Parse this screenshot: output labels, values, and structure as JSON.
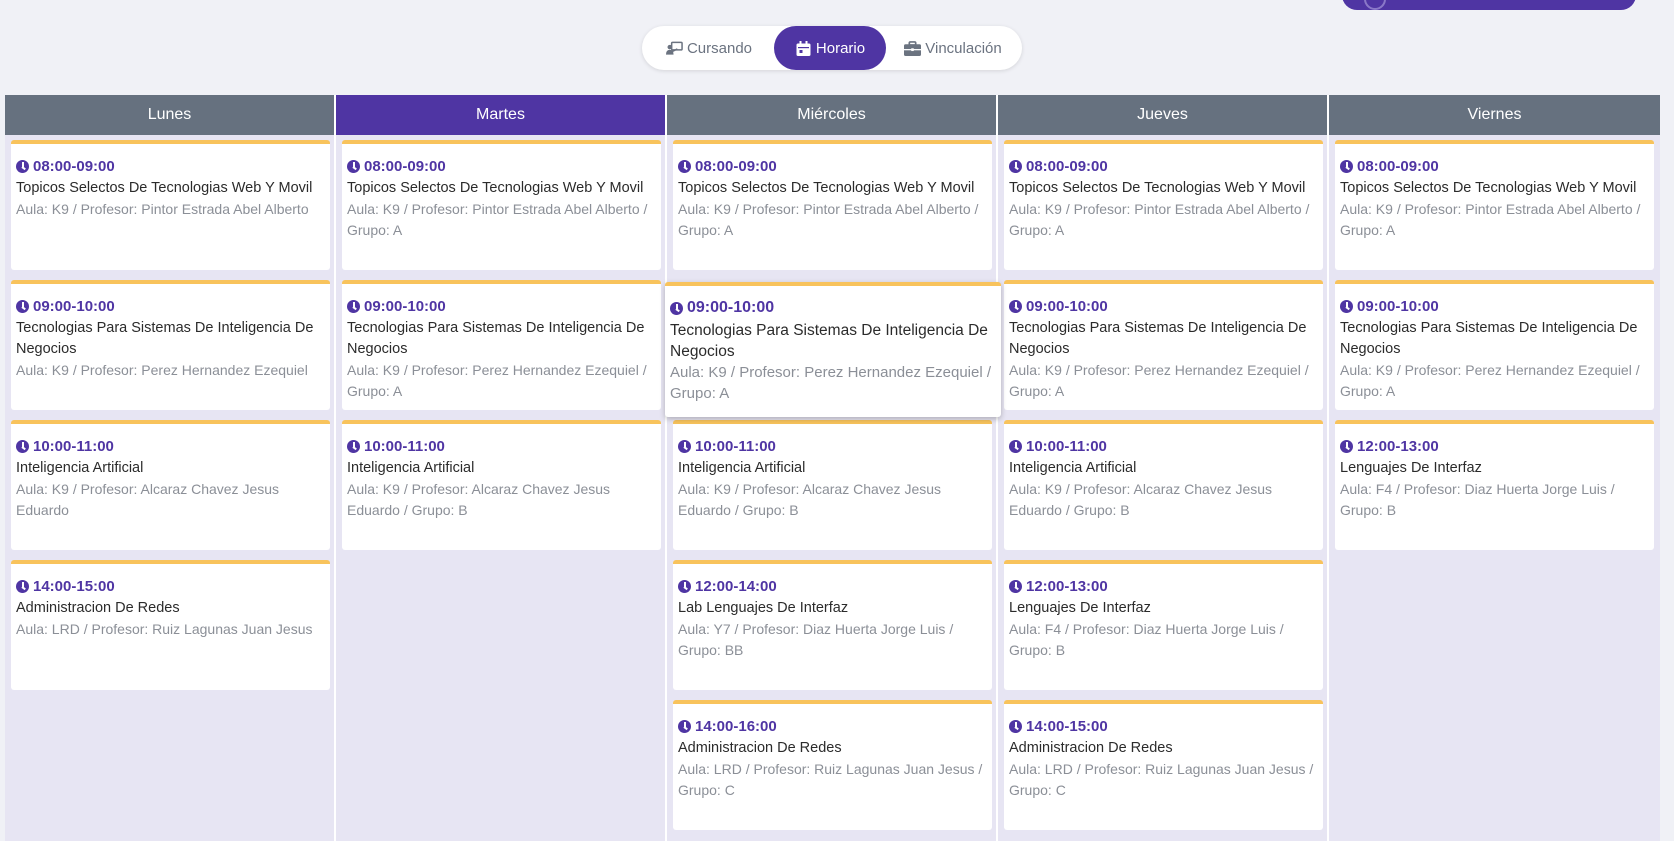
{
  "tabs": [
    {
      "label": "Cursando",
      "icon": "teacher-board-icon"
    },
    {
      "label": "Horario",
      "icon": "calendar-icon"
    },
    {
      "label": "Vinculación",
      "icon": "briefcase-icon"
    }
  ],
  "colors": {
    "primary": "#4f35a3",
    "header": "#66717f",
    "accent": "#f8c35c"
  },
  "days": [
    {
      "name": "Lunes",
      "active": false,
      "classes": [
        {
          "time": "08:00-09:00",
          "subject": "Topicos Selectos De Tecnologias Web Y Movil",
          "details": "Aula: K9 / Profesor: Pintor Estrada Abel Alberto"
        },
        {
          "time": "09:00-10:00",
          "subject": "Tecnologias Para Sistemas De Inteligencia De Negocios",
          "details": "Aula: K9 / Profesor: Perez Hernandez Ezequiel"
        },
        {
          "time": "10:00-11:00",
          "subject": "Inteligencia Artificial",
          "details": "Aula: K9 / Profesor: Alcaraz Chavez Jesus Eduardo"
        },
        {
          "time": "14:00-15:00",
          "subject": "Administracion De Redes",
          "details": "Aula: LRD / Profesor: Ruiz Lagunas Juan Jesus"
        }
      ]
    },
    {
      "name": "Martes",
      "active": true,
      "classes": [
        {
          "time": "08:00-09:00",
          "subject": "Topicos Selectos De Tecnologias Web Y Movil",
          "details": "Aula: K9 / Profesor: Pintor Estrada Abel Alberto / Grupo: A"
        },
        {
          "time": "09:00-10:00",
          "subject": "Tecnologias Para Sistemas De Inteligencia De Negocios",
          "details": "Aula: K9 / Profesor: Perez Hernandez Ezequiel / Grupo: A"
        },
        {
          "time": "10:00-11:00",
          "subject": "Inteligencia Artificial",
          "details": "Aula: K9 / Profesor: Alcaraz Chavez Jesus Eduardo / Grupo: B"
        }
      ]
    },
    {
      "name": "Miércoles",
      "active": false,
      "classes": [
        {
          "time": "08:00-09:00",
          "subject": "Topicos Selectos De Tecnologias Web Y Movil",
          "details": "Aula: K9 / Profesor: Pintor Estrada Abel Alberto / Grupo: A"
        },
        {
          "time": "09:00-10:00",
          "subject": "Tecnologias Para Sistemas De Inteligencia De Negocios",
          "details": "Aula: K9 / Profesor: Perez Hernandez Ezequiel / Grupo: A",
          "hover": true
        },
        {
          "time": "10:00-11:00",
          "subject": "Inteligencia Artificial",
          "details": "Aula: K9 / Profesor: Alcaraz Chavez Jesus Eduardo / Grupo: B"
        },
        {
          "time": "12:00-14:00",
          "subject": "Lab Lenguajes De Interfaz",
          "details": "Aula: Y7 / Profesor: Diaz Huerta Jorge Luis / Grupo: BB"
        },
        {
          "time": "14:00-16:00",
          "subject": "Administracion De Redes",
          "details": "Aula: LRD / Profesor: Ruiz Lagunas Juan Jesus / Grupo: C"
        }
      ]
    },
    {
      "name": "Jueves",
      "active": false,
      "classes": [
        {
          "time": "08:00-09:00",
          "subject": "Topicos Selectos De Tecnologias Web Y Movil",
          "details": "Aula: K9 / Profesor: Pintor Estrada Abel Alberto / Grupo: A"
        },
        {
          "time": "09:00-10:00",
          "subject": "Tecnologias Para Sistemas De Inteligencia De Negocios",
          "details": "Aula: K9 / Profesor: Perez Hernandez Ezequiel / Grupo: A"
        },
        {
          "time": "10:00-11:00",
          "subject": "Inteligencia Artificial",
          "details": "Aula: K9 / Profesor: Alcaraz Chavez Jesus Eduardo / Grupo: B"
        },
        {
          "time": "12:00-13:00",
          "subject": "Lenguajes De Interfaz",
          "details": "Aula: F4 / Profesor: Diaz Huerta Jorge Luis / Grupo: B"
        },
        {
          "time": "14:00-15:00",
          "subject": "Administracion De Redes",
          "details": "Aula: LRD / Profesor: Ruiz Lagunas Juan Jesus / Grupo: C"
        }
      ]
    },
    {
      "name": "Viernes",
      "active": false,
      "classes": [
        {
          "time": "08:00-09:00",
          "subject": "Topicos Selectos De Tecnologias Web Y Movil",
          "details": "Aula: K9 / Profesor: Pintor Estrada Abel Alberto / Grupo: A"
        },
        {
          "time": "09:00-10:00",
          "subject": "Tecnologias Para Sistemas De Inteligencia De Negocios",
          "details": "Aula: K9 / Profesor: Perez Hernandez Ezequiel / Grupo: A"
        },
        {
          "time": "12:00-13:00",
          "subject": "Lenguajes De Interfaz",
          "details": "Aula: F4 / Profesor: Diaz Huerta Jorge Luis / Grupo: B"
        }
      ]
    }
  ]
}
